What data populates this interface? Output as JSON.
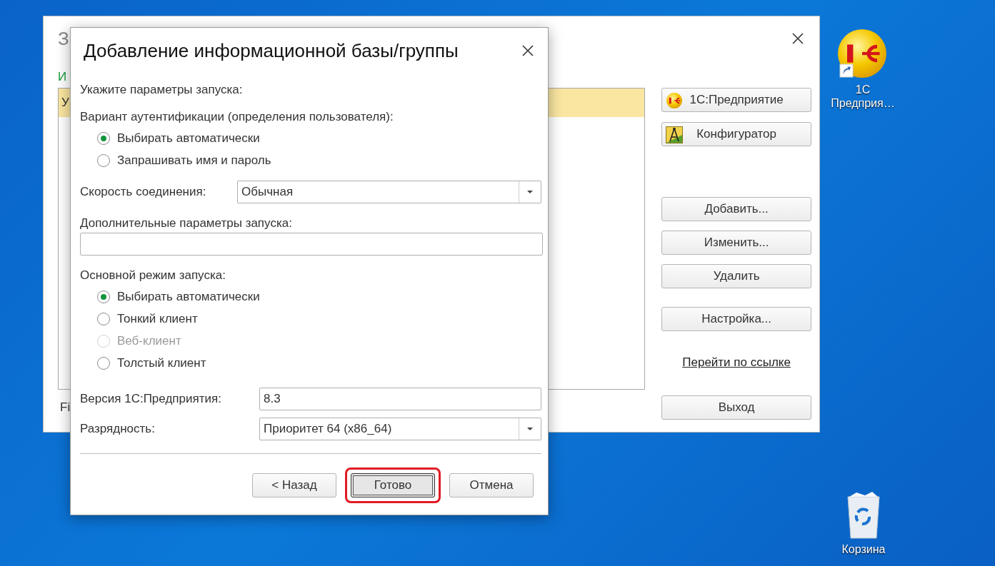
{
  "desktop": {
    "icons": [
      {
        "kind": "app",
        "label": "1С Предприя…"
      },
      {
        "kind": "trash",
        "label": "Корзина"
      }
    ]
  },
  "back_window": {
    "title": "З",
    "section_label": "И",
    "list": {
      "rows": [
        {
          "text": "У",
          "selected": true
        }
      ]
    },
    "footer": "Fi",
    "button_groups": [
      [
        {
          "kind": "app",
          "label": "1С:Предприятие"
        },
        {
          "kind": "designer",
          "label": "Конфигуратор"
        }
      ],
      [
        {
          "kind": "plain",
          "label": "Добавить..."
        },
        {
          "kind": "plain",
          "label": "Изменить..."
        },
        {
          "kind": "plain",
          "label": "Удалить"
        }
      ],
      [
        {
          "kind": "plain",
          "label": "Настройка..."
        }
      ]
    ],
    "link": "Перейти по ссылке",
    "exit_button": "Выход"
  },
  "dialog": {
    "title": "Добавление информационной базы/группы",
    "intro": "Укажите параметры запуска:",
    "auth": {
      "label": "Вариант аутентификации (определения пользователя):",
      "options": [
        {
          "label": "Выбирать автоматически",
          "selected": true,
          "disabled": false
        },
        {
          "label": "Запрашивать имя и пароль",
          "selected": false,
          "disabled": false
        }
      ]
    },
    "speed": {
      "label": "Скорость соединения:",
      "value": "Обычная"
    },
    "extra_params": {
      "label": "Дополнительные параметры запуска:"
    },
    "launch_mode": {
      "label": "Основной режим запуска:",
      "options": [
        {
          "label": "Выбирать автоматически",
          "selected": true,
          "disabled": false
        },
        {
          "label": "Тонкий клиент",
          "selected": false,
          "disabled": false
        },
        {
          "label": "Веб-клиент",
          "selected": false,
          "disabled": true
        },
        {
          "label": "Толстый клиент",
          "selected": false,
          "disabled": false
        }
      ]
    },
    "version": {
      "label": "Версия 1С:Предприятия:",
      "value": "8.3"
    },
    "bitness": {
      "label": "Разрядность:",
      "value": "Приоритет 64 (x86_64)"
    },
    "buttons": [
      {
        "label": "< Назад",
        "focused": false,
        "highlighted": false
      },
      {
        "label": "Готово",
        "focused": true,
        "highlighted": true
      },
      {
        "label": "Отмена",
        "focused": false,
        "highlighted": false
      }
    ]
  }
}
